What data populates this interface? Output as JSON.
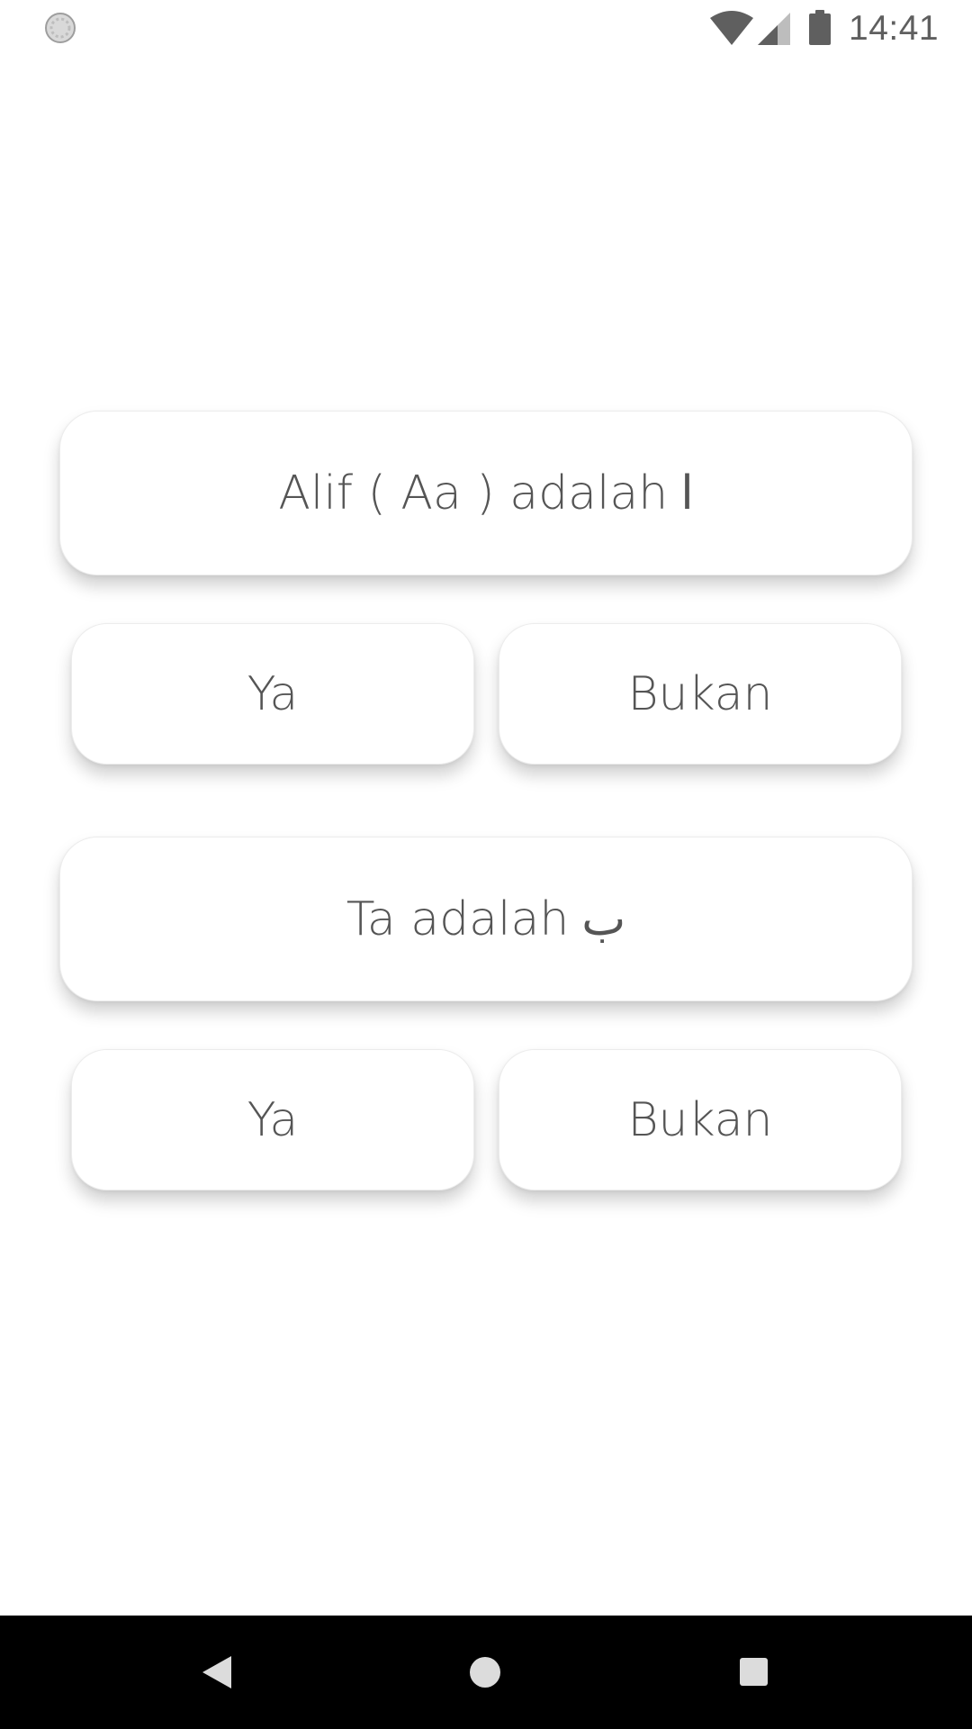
{
  "status_bar": {
    "time": "14:41",
    "icons": [
      "sync-icon",
      "wifi-icon",
      "signal-icon",
      "battery-icon"
    ]
  },
  "questions": [
    {
      "text": "Alif ( Aa ) adalah",
      "letter": "ا",
      "yes_label": "Ya",
      "no_label": "Bukan"
    },
    {
      "text": "Ta adalah",
      "letter": "ب",
      "yes_label": "Ya",
      "no_label": "Bukan"
    }
  ],
  "navigation_bar": {
    "icons": [
      "back-icon",
      "home-icon",
      "recents-icon"
    ]
  },
  "colors": {
    "background": "#ffffff",
    "text": "#555555",
    "status_icons": "#5f5f5f",
    "nav_bar": "#000000",
    "nav_icons": "#dcdcdc"
  }
}
